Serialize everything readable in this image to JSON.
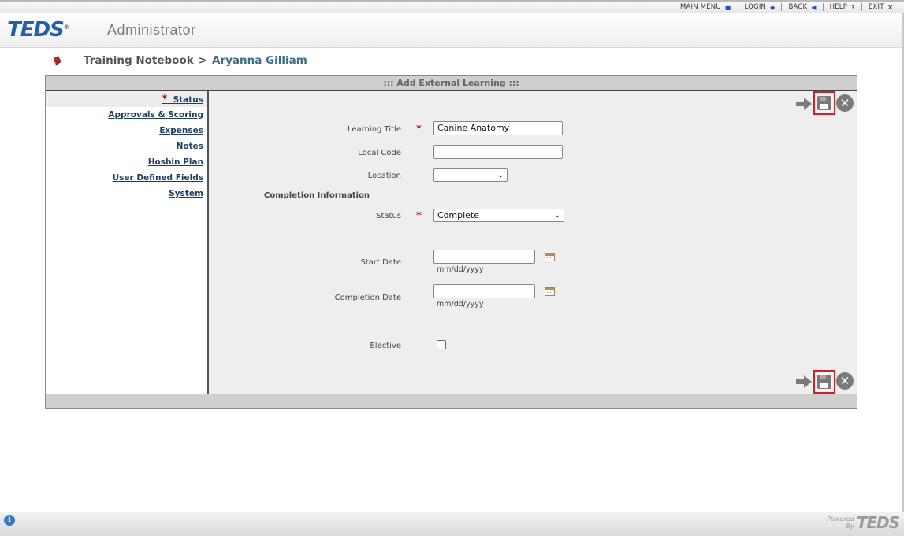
{
  "topnav": {
    "main_menu": "MAIN MENU",
    "login": "LOGIN",
    "back": "BACK",
    "help": "HELP",
    "exit": "EXIT"
  },
  "header": {
    "logo": "TEDS",
    "app_name": "Administrator"
  },
  "breadcrumb": {
    "section": "Training Notebook",
    "separator": ">",
    "person": "Aryanna Gilliam"
  },
  "panel": {
    "title": "::: Add External Learning :::"
  },
  "sidebar": {
    "items": [
      {
        "label": "Status",
        "required": "*",
        "active": true
      },
      {
        "label": "Approvals & Scoring"
      },
      {
        "label": "Expenses"
      },
      {
        "label": "Notes"
      },
      {
        "label": "Hoshin Plan"
      },
      {
        "label": "User Defined Fields"
      },
      {
        "label": "System"
      }
    ]
  },
  "form": {
    "required_mark": "*",
    "learning_title": {
      "label": "Learning Title",
      "value": "Canine Anatomy"
    },
    "local_code": {
      "label": "Local Code",
      "value": ""
    },
    "location": {
      "label": "Location",
      "value": ""
    },
    "completion_section": "Completion Information",
    "status": {
      "label": "Status",
      "value": "Complete"
    },
    "start_date": {
      "label": "Start Date",
      "value": "",
      "hint": "mm/dd/yyyy"
    },
    "completion_date": {
      "label": "Completion Date",
      "value": "",
      "hint": "mm/dd/yyyy"
    },
    "elective": {
      "label": "Elective",
      "checked": false
    }
  },
  "footer": {
    "powered": "Powered",
    "by": "By",
    "logo": "TEDS"
  },
  "colors": {
    "accent_blue": "#1d5fb0",
    "required_red": "#b01515",
    "highlight_red": "#d42020"
  }
}
